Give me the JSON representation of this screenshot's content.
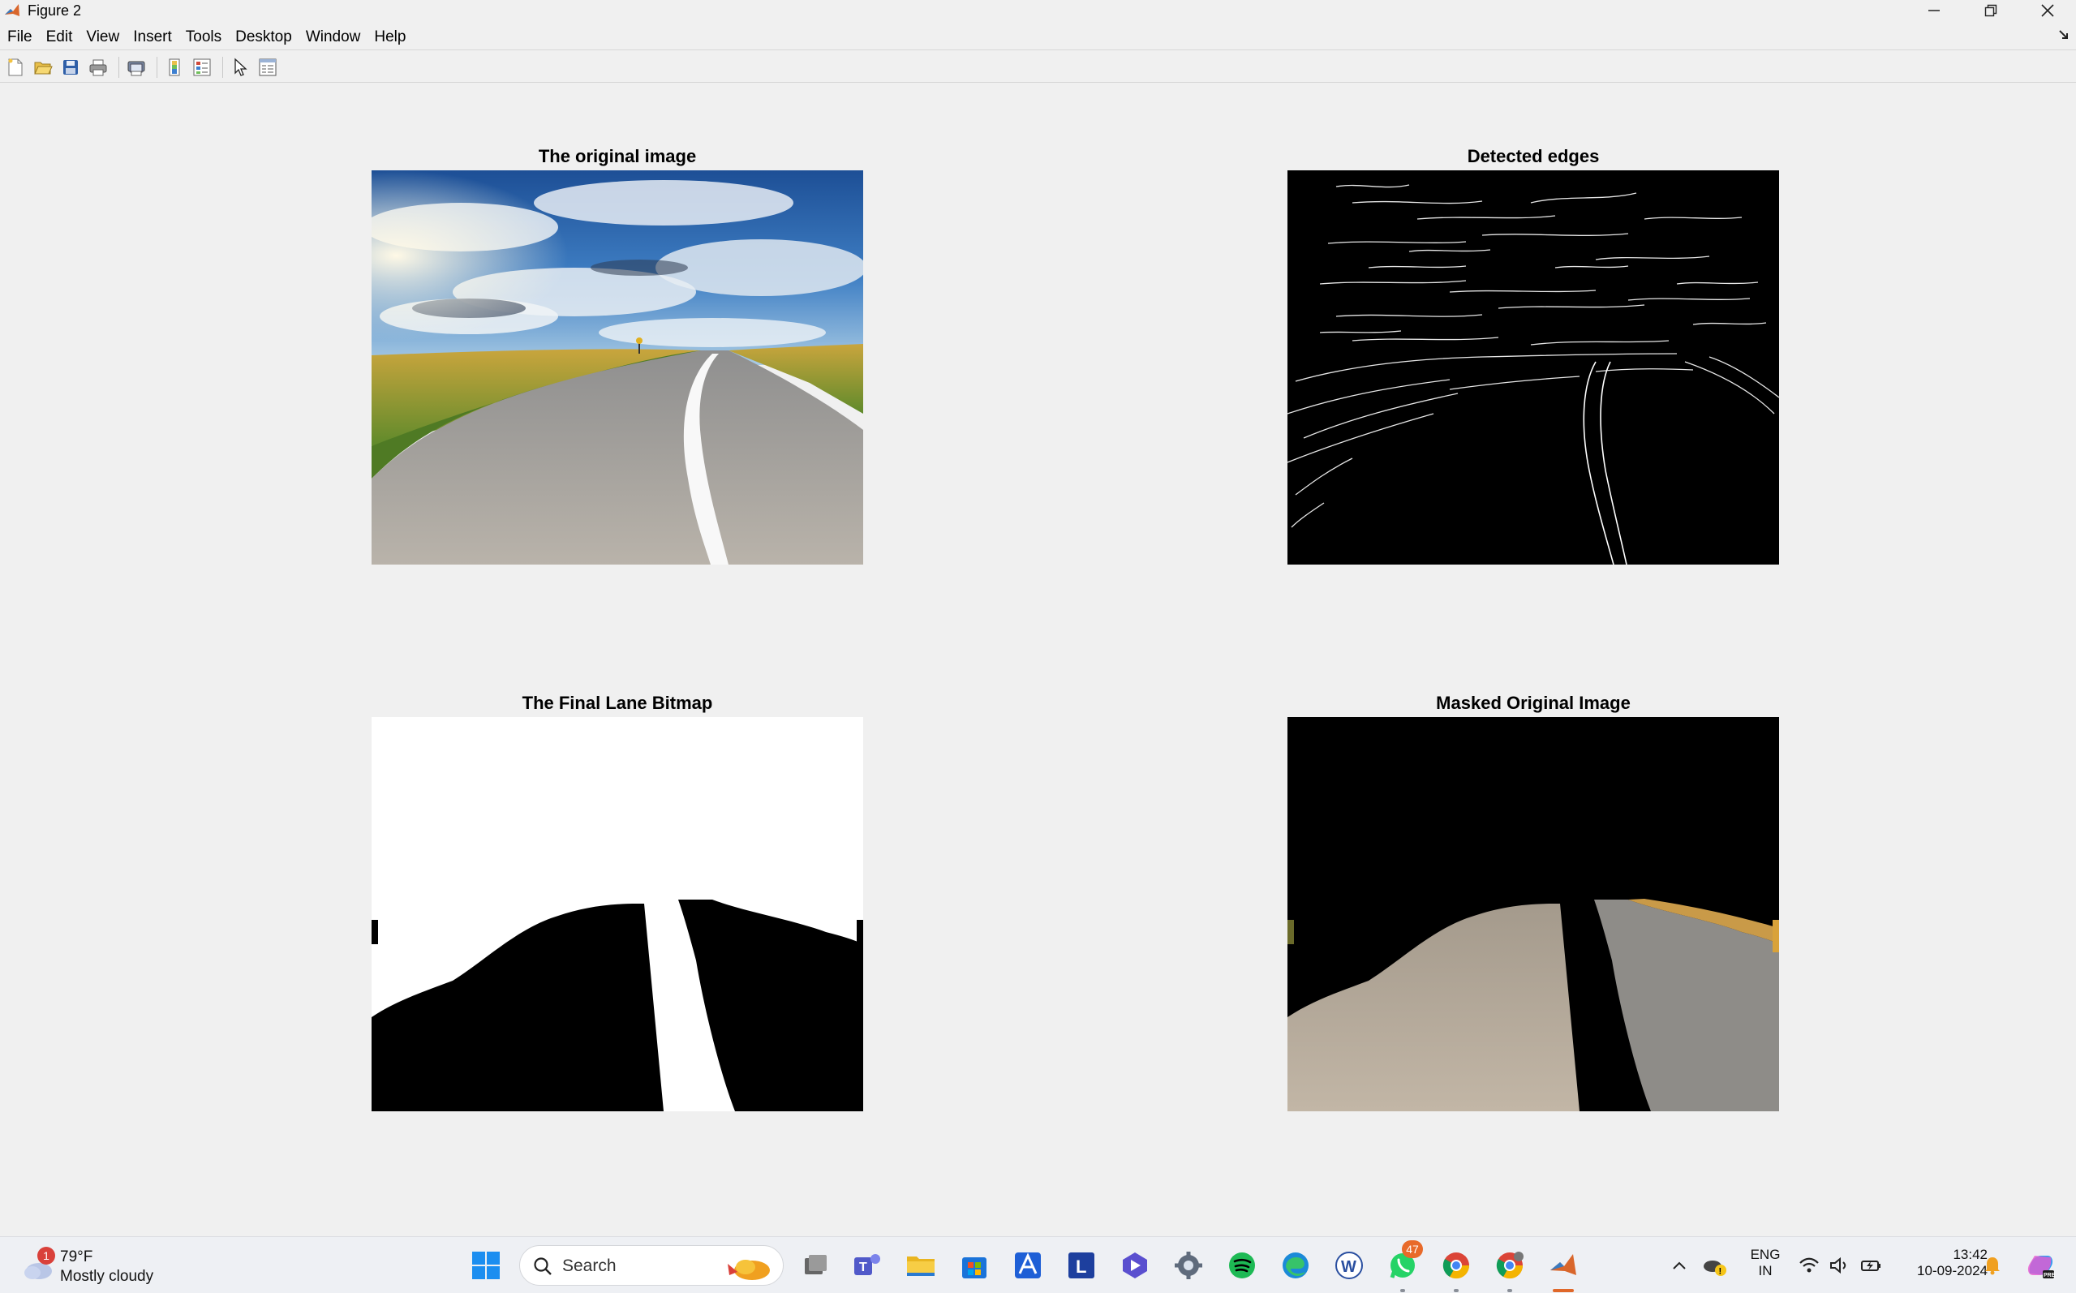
{
  "window": {
    "title": "Figure 2"
  },
  "menu": [
    "File",
    "Edit",
    "View",
    "Insert",
    "Tools",
    "Desktop",
    "Window",
    "Help"
  ],
  "toolbar": {
    "icons": [
      "new-figure-icon",
      "open-file-icon",
      "save-icon",
      "print-icon",
      "print-preview-icon",
      "colorbar-icon",
      "legend-icon",
      "pointer-icon",
      "property-inspector-icon"
    ]
  },
  "figure": {
    "subplots": [
      {
        "title": "The original image"
      },
      {
        "title": "Detected edges"
      },
      {
        "title": "The Final Lane Bitmap"
      },
      {
        "title": "Masked Original Image"
      }
    ]
  },
  "taskbar": {
    "weather": {
      "temp": "79°F",
      "condition": "Mostly cloudy",
      "badge": "1"
    },
    "search": {
      "label": "Search"
    },
    "apps": [
      "start-icon",
      "task-view-icon",
      "teams-icon",
      "file-explorer-icon",
      "microsoft-store-icon",
      "app-icon",
      "l-app-icon",
      "copilot-app-icon",
      "settings-icon",
      "spotify-icon",
      "edge-icon",
      "w-app-icon",
      "whatsapp-icon",
      "chrome-icon",
      "chrome-profile-icon",
      "matlab-icon"
    ],
    "whatsapp_badge": "47",
    "language": {
      "line1": "ENG",
      "line2": "IN"
    },
    "clock": {
      "time": "13:42",
      "date": "10-09-2024"
    },
    "colors": {
      "accent": "#e0682a"
    }
  }
}
